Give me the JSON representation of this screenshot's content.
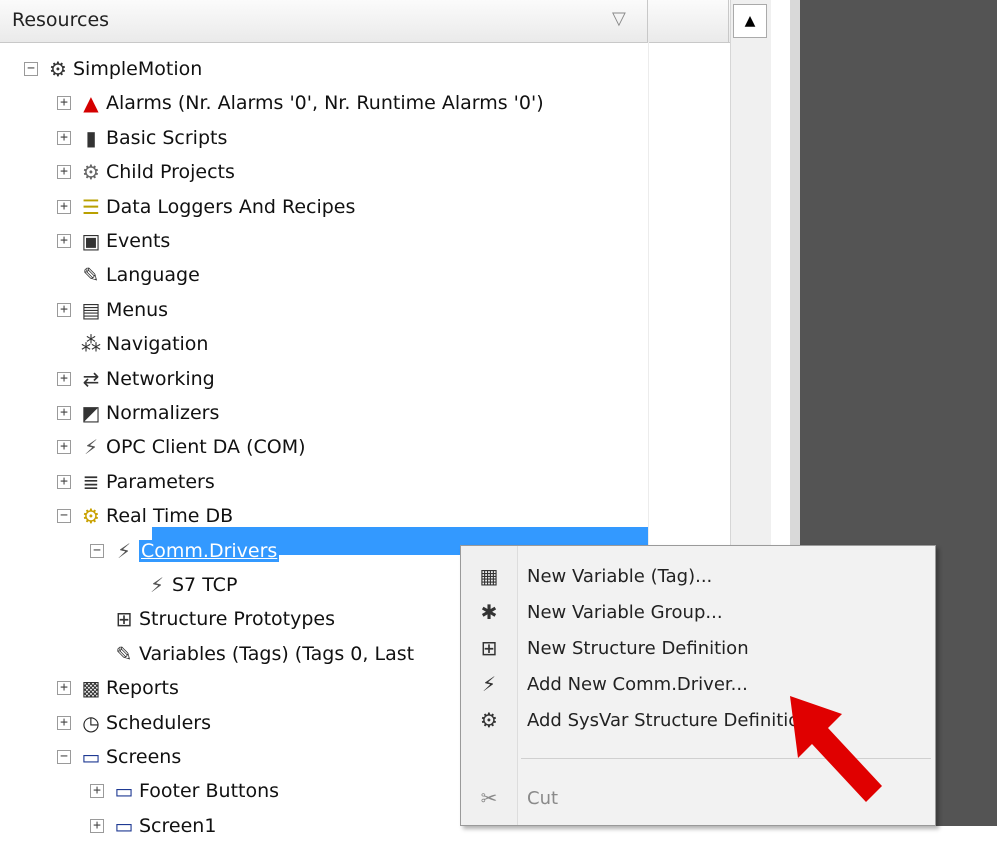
{
  "header": {
    "title": "Resources",
    "filter_icon": "filter-icon",
    "scroll_up": "▲"
  },
  "tree": [
    {
      "label": "SimpleMotion",
      "expander": "−",
      "icon": "gear-icon",
      "glyph": "⚙",
      "color": "#333333",
      "level": 0
    },
    {
      "label": "Alarms (Nr. Alarms '0', Nr. Runtime Alarms '0')",
      "expander": "+",
      "icon": "alarm-bell-icon",
      "glyph": "▲",
      "color": "#d40000",
      "level": 1
    },
    {
      "label": "Basic Scripts",
      "expander": "+",
      "icon": "script-icon",
      "glyph": "▮",
      "color": "#333333",
      "level": 1
    },
    {
      "label": "Child Projects",
      "expander": "+",
      "icon": "child-projects-icon",
      "glyph": "⚙",
      "color": "#666666",
      "level": 1
    },
    {
      "label": "Data Loggers And Recipes",
      "expander": "+",
      "icon": "database-icon",
      "glyph": "☰",
      "color": "#b9a000",
      "level": 1
    },
    {
      "label": "Events",
      "expander": "+",
      "icon": "events-icon",
      "glyph": "▣",
      "color": "#333333",
      "level": 1
    },
    {
      "label": "Language",
      "expander": "",
      "icon": "language-icon",
      "glyph": "✎",
      "color": "#333333",
      "level": 1
    },
    {
      "label": "Menus",
      "expander": "+",
      "icon": "menus-icon",
      "glyph": "▤",
      "color": "#333333",
      "level": 1
    },
    {
      "label": "Navigation",
      "expander": "",
      "icon": "navigation-icon",
      "glyph": "⁂",
      "color": "#333333",
      "level": 1
    },
    {
      "label": "Networking",
      "expander": "+",
      "icon": "networking-icon",
      "glyph": "⇄",
      "color": "#333333",
      "level": 1
    },
    {
      "label": "Normalizers",
      "expander": "+",
      "icon": "normalizers-icon",
      "glyph": "◩",
      "color": "#333333",
      "level": 1
    },
    {
      "label": "OPC Client DA (COM)",
      "expander": "+",
      "icon": "opc-plug-icon",
      "glyph": "⚡",
      "color": "#555555",
      "level": 1
    },
    {
      "label": "Parameters",
      "expander": "+",
      "icon": "parameters-icon",
      "glyph": "≣",
      "color": "#333333",
      "level": 1
    },
    {
      "label": "Real Time DB",
      "expander": "−",
      "icon": "realtime-db-gear-icon",
      "glyph": "⚙",
      "color": "#c9a100",
      "level": 1
    },
    {
      "label": "Comm.Drivers",
      "expander": "−",
      "icon": "comm-drivers-plug-icon",
      "glyph": "⚡",
      "color": "#555555",
      "level": 2,
      "selected": true
    },
    {
      "label": "S7 TCP",
      "expander": "",
      "icon": "plug-icon",
      "glyph": "⚡",
      "color": "#555555",
      "level": 3
    },
    {
      "label": "Structure Prototypes",
      "expander": "",
      "icon": "structure-icon",
      "glyph": "⊞",
      "color": "#333333",
      "level": 2
    },
    {
      "label": "Variables (Tags) (Tags 0, Last",
      "expander": "",
      "icon": "variables-icon",
      "glyph": "✎",
      "color": "#333333",
      "level": 2
    },
    {
      "label": "Reports",
      "expander": "+",
      "icon": "reports-icon",
      "glyph": "▩",
      "color": "#333333",
      "level": 1
    },
    {
      "label": "Schedulers",
      "expander": "+",
      "icon": "scheduler-clock-icon",
      "glyph": "◷",
      "color": "#222222",
      "level": 1
    },
    {
      "label": "Screens",
      "expander": "−",
      "icon": "screens-monitor-icon",
      "glyph": "▭",
      "color": "#1f3a93",
      "level": 1
    },
    {
      "label": "Footer Buttons",
      "expander": "+",
      "icon": "monitor-icon",
      "glyph": "▭",
      "color": "#1f3a93",
      "level": 2
    },
    {
      "label": "Screen1",
      "expander": "+",
      "icon": "monitor-icon",
      "glyph": "▭",
      "color": "#1f3a93",
      "level": 2
    }
  ],
  "context_menu": [
    {
      "label": "New Variable (Tag)...",
      "icon": "new-variable-icon",
      "glyph": "▦",
      "disabled": false
    },
    {
      "label": "New Variable Group...",
      "icon": "new-group-icon",
      "glyph": "✱",
      "disabled": false
    },
    {
      "label": "New Structure Definition",
      "icon": "structure-definition-icon",
      "glyph": "⊞",
      "disabled": false
    },
    {
      "label": "Add New Comm.Driver...",
      "icon": "add-comm-driver-icon",
      "glyph": "⚡",
      "disabled": false
    },
    {
      "label": "Add SysVar Structure Definition",
      "icon": "sysvar-icon",
      "glyph": "⚙",
      "disabled": false
    },
    {
      "label": "Cut",
      "icon": "cut-icon",
      "glyph": "✂",
      "disabled": true
    }
  ],
  "annotation": {
    "arrow_color": "#e00000"
  }
}
